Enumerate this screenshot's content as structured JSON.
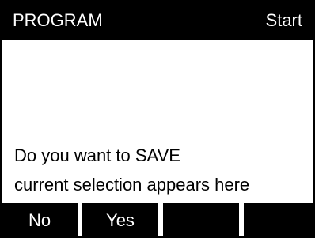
{
  "header": {
    "title": "PROGRAM",
    "status": "Start"
  },
  "prompt": {
    "line1": "Do you want to SAVE",
    "line2": "current selection appears here"
  },
  "softkeys": [
    {
      "label": "No"
    },
    {
      "label": "Yes"
    },
    {
      "label": ""
    },
    {
      "label": ""
    }
  ],
  "colors": {
    "bar": "#000000",
    "text_inverse": "#ffffff",
    "text": "#000000",
    "background": "#ffffff"
  }
}
